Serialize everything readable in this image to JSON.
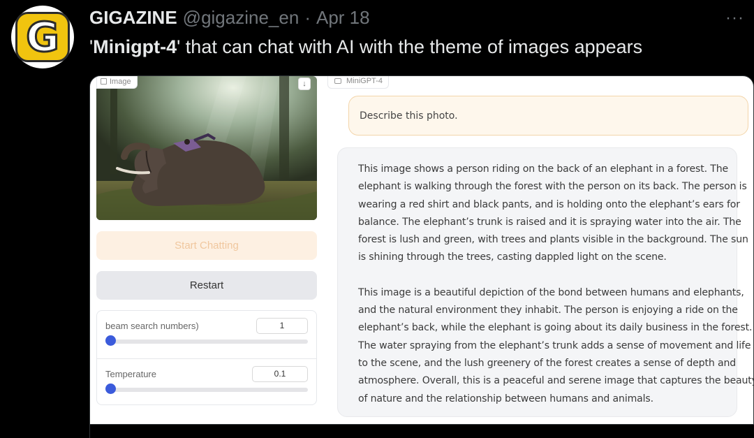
{
  "tweet": {
    "author_name": "GIGAZINE",
    "handle": "@gigazine_en",
    "separator": "·",
    "date": "Apr 18",
    "more": "···",
    "avatar_letter": "G",
    "text_open_quote": "'",
    "text_bold": "Minigpt-4",
    "text_rest": "' that can chat with AI with the theme of images appears"
  },
  "screenshot": {
    "image_label": "Image",
    "start_chatting": "Start Chatting",
    "restart": "Restart",
    "beam_label": "beam search numbers)",
    "beam_value": "1",
    "beam_level": 0,
    "temperature_label": "Temperature",
    "temperature_value": "0.1",
    "temperature_level": 0,
    "chat_label": "MiniGPT-4",
    "user_message": "Describe this photo.",
    "bot_lines": [
      "This image shows a person riding on the back of an elephant in a forest. The",
      "elephant is walking through the forest with the person on its back. The person is",
      "wearing a red shirt and black pants, and is holding onto the elephant’s ears for",
      "balance. The elephant’s trunk is raised and it is spraying water into the air. The",
      "forest is lush and green, with trees and plants visible in the background. The sun",
      "is shining through the trees, casting dappled light on the scene.",
      "",
      "This image is a beautiful depiction of the bond between humans and elephants,",
      "and the natural environment they inhabit. The person is enjoying a ride on the",
      "elephant’s back, while the elephant is going about its daily business in the forest.",
      "The water spraying from the elephant’s trunk adds a sense of movement and life",
      "to the scene, and the lush greenery of the forest creates a sense of depth and",
      "atmosphere. Overall, this is a peaceful and serene image that captures the beauty",
      "of nature and the relationship between humans and animals."
    ]
  },
  "colors": {
    "background": "#000000",
    "text": "#e7e9ea",
    "muted": "#71767b",
    "slider_accent": "#3b5bdb",
    "start_button_bg": "#fdf0e2",
    "user_bubble_border": "#f3d5aa"
  }
}
